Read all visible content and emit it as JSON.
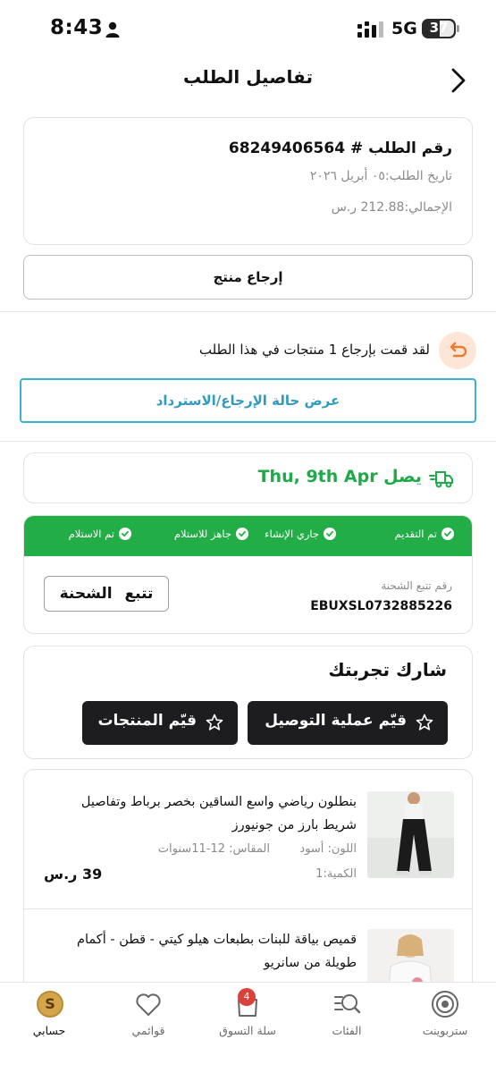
{
  "status_bar": {
    "time": "8:43",
    "network": "5G",
    "battery": "37"
  },
  "header": {
    "title": "تفاصيل الطلب"
  },
  "order": {
    "number": "رقم الطلب # 68249406564",
    "date": "تاريخ الطلب:٠٥ أبريل ٢٠٢٦",
    "total": "الإجمالي:212.88 ر.س"
  },
  "return_button": "إرجاع منتج",
  "returns": {
    "message": "لقد قمت بإرجاع 1 منتجات في هذا الطلب",
    "refund_button": "عرض حالة الإرجاع/الاسترداد"
  },
  "delivery": {
    "text": "يصل Thu, 9th Apr",
    "accent": "#1faa4a"
  },
  "tracking": {
    "steps": [
      "تم التقديم",
      "جاري الإنشاء",
      "جاهز للاستلام",
      "تم الاستلام"
    ],
    "label": "رقم تتبع الشحنة",
    "number": "EBUXSL0732885226",
    "track_button": "تتبع الشحنة"
  },
  "share": {
    "title": "شارك تجربتك",
    "rate_delivery": "قيّم عملية التوصيل",
    "rate_products": "قيّم المنتجات"
  },
  "products": [
    {
      "name": "بنطلون رياضي واسع الساقين بخصر برباط وتفاصيل شريط بارز من جونيورز",
      "color": "اللون: أسود",
      "size": "المقاس: 12-11سنوات",
      "quantity": "الكمية:1",
      "price": "39 ر.س"
    },
    {
      "name": "قميص بياقة للبنات بطبعات هيلو كيتي - قطن - أكمام طويلة من سانريو"
    }
  ],
  "bottom_nav": {
    "items": [
      {
        "label": "ستربوينت",
        "icon": "target-icon"
      },
      {
        "label": "الفئات",
        "icon": "categories-search-icon"
      },
      {
        "label": "سلة التسوق",
        "icon": "bag-icon",
        "badge": "4"
      },
      {
        "label": "قوائمي",
        "icon": "heart-icon"
      },
      {
        "label": "حسابي",
        "icon": "coin-icon",
        "coin": "S"
      }
    ]
  }
}
